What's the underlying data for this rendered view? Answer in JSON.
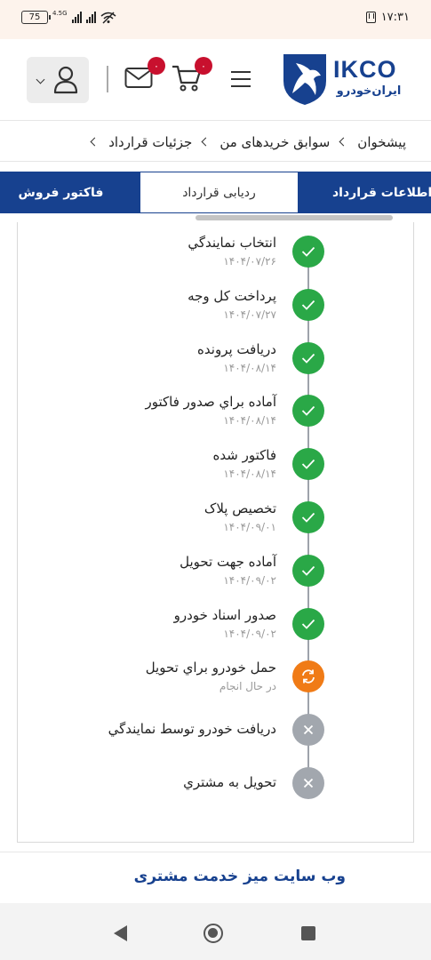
{
  "status_bar": {
    "battery": "75",
    "network": "4.5G",
    "time": "۱۷:۳۱"
  },
  "header": {
    "logo_text": "IKCO",
    "logo_subtext": "ایران‌خودرو",
    "cart_count": "۰",
    "messages_count": "۰"
  },
  "breadcrumb": {
    "items": [
      "پیشخوان",
      "سوابق خریدهای من",
      "جزئیات قرارداد"
    ]
  },
  "tabs": {
    "contract_info": "اطلاعات قرارداد",
    "tracking": "ردیابی قرارداد",
    "sales_invoice": "فاکتور فروش"
  },
  "timeline": {
    "steps": [
      {
        "title": "انتخاب نمایندگي",
        "date": "۱۴۰۴/۰۷/۲۶",
        "status": "done"
      },
      {
        "title": "پرداخت کل وجه",
        "date": "۱۴۰۴/۰۷/۲۷",
        "status": "done"
      },
      {
        "title": "دريافت پرونده",
        "date": "۱۴۰۴/۰۸/۱۴",
        "status": "done"
      },
      {
        "title": "آماده براي صدور فاکتور",
        "date": "۱۴۰۴/۰۸/۱۴",
        "status": "done"
      },
      {
        "title": "فاکتور شده",
        "date": "۱۴۰۴/۰۸/۱۴",
        "status": "done"
      },
      {
        "title": "تخصيص پلاک",
        "date": "۱۴۰۴/۰۹/۰۱",
        "status": "done"
      },
      {
        "title": "آماده جهت تحويل",
        "date": "۱۴۰۴/۰۹/۰۲",
        "status": "done"
      },
      {
        "title": "صدور اسناد خودرو",
        "date": "۱۴۰۴/۰۹/۰۲",
        "status": "done"
      },
      {
        "title": "حمل خودرو براي تحويل",
        "date": "در حال انجام",
        "status": "in-progress"
      },
      {
        "title": "دريافت خودرو توسط نمايندگي",
        "date": "",
        "status": "pending"
      },
      {
        "title": "تحويل به مشتري",
        "date": "",
        "status": "pending"
      }
    ]
  },
  "footer": {
    "link_text": "وب سایت میز خدمت مشتری"
  },
  "colors": {
    "brand_blue": "#17418f",
    "done_green": "#2aa847",
    "progress_orange": "#f07b16",
    "pending_gray": "#a2a7ae",
    "badge_red": "#c8102e"
  }
}
